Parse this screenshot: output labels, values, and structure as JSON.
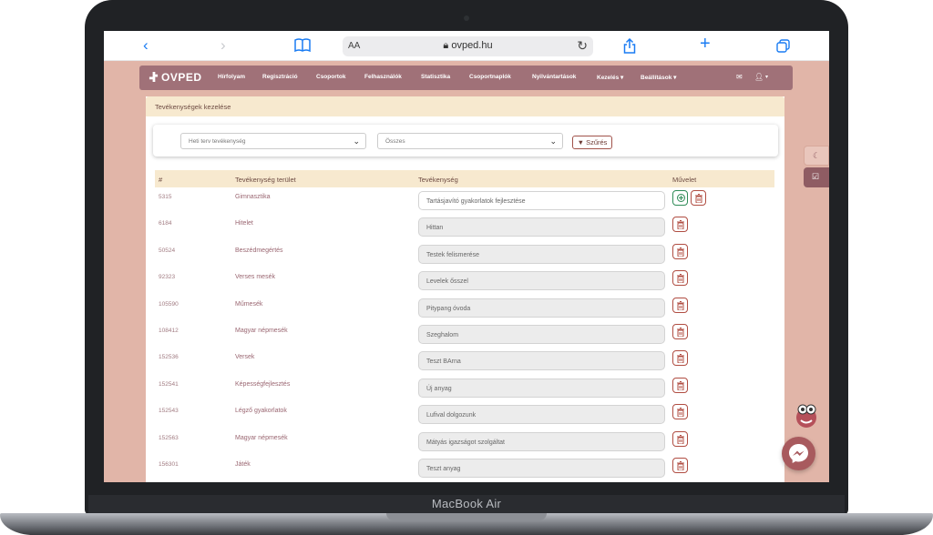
{
  "device": {
    "brand_label": "MacBook Air"
  },
  "browser": {
    "url": "ovped.hu",
    "text_size_label": "AA",
    "icons": [
      "back-icon",
      "forward-icon",
      "bookmarks-icon",
      "reload-icon",
      "share-icon",
      "new-tab-icon",
      "tabs-icon"
    ]
  },
  "nav": {
    "logo": "OVPED",
    "items": [
      "Hírfolyam",
      "Regisztráció",
      "Csoportok",
      "Felhasználók",
      "Statisztika",
      "Csoportnaplók",
      "Nyilvántartások",
      "Kezelés ▾",
      "Beállítások ▾"
    ],
    "right_icons": [
      "mail-icon",
      "user-icon"
    ],
    "user_caret": "▾"
  },
  "page": {
    "title": "Tevékenységek kezelése",
    "filter": {
      "type_select": "Heti terv tevékenység",
      "area_select": "Összes",
      "button": "Szűrés"
    },
    "table": {
      "headers": [
        "#",
        "Tevékenység terület",
        "Tevékenység",
        "Művelet"
      ],
      "rows": [
        {
          "id": "5315",
          "area": "Gimnasztika",
          "activity": "Tartásjavító gyakorlatok fejlesztése",
          "editable": true
        },
        {
          "id": "6184",
          "area": "Hitelet",
          "activity": "Hittan",
          "editable": false
        },
        {
          "id": "50524",
          "area": "Beszédmegértés",
          "activity": "Testek felismerése",
          "editable": false
        },
        {
          "id": "92323",
          "area": "Verses mesék",
          "activity": "Levelek ősszel",
          "editable": false
        },
        {
          "id": "105590",
          "area": "Műmesék",
          "activity": "Pitypang óvoda",
          "editable": false
        },
        {
          "id": "108412",
          "area": "Magyar népmesék",
          "activity": "Szeghalom",
          "editable": false
        },
        {
          "id": "152536",
          "area": "Versek",
          "activity": "Teszt BArna",
          "editable": false
        },
        {
          "id": "152541",
          "area": "Képességfejlesztés",
          "activity": "Új anyag",
          "editable": false
        },
        {
          "id": "152543",
          "area": "Légző gyakorlatok",
          "activity": "Lufival dolgozunk",
          "editable": false
        },
        {
          "id": "152563",
          "area": "Magyar népmesék",
          "activity": "Mátyás igazságot szolgáltat",
          "editable": false
        },
        {
          "id": "156301",
          "area": "Játék",
          "activity": "Teszt anyag",
          "editable": false
        }
      ]
    }
  },
  "colors": {
    "nav": "#a07178",
    "page_bg": "#e1b5a8",
    "header_bg": "#f7e9cf",
    "danger": "#b04d42",
    "success": "#2e8b57"
  }
}
